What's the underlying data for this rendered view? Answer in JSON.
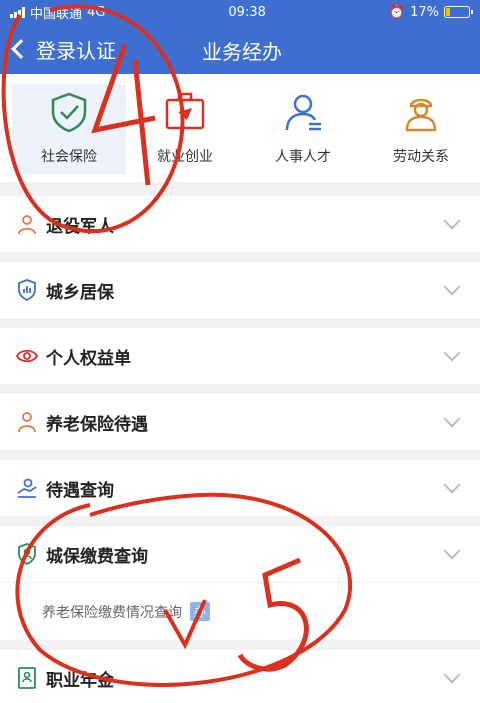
{
  "statusbar": {
    "carrier": "中国联通",
    "network": "4G",
    "time": "09:38",
    "battery": "17%"
  },
  "nav": {
    "back_label": "登录认证",
    "title": "业务经办"
  },
  "categories": [
    {
      "label": "社会保险",
      "icon": "shield-check-icon",
      "active": true
    },
    {
      "label": "就业创业",
      "icon": "briefcase-icon"
    },
    {
      "label": "人事人才",
      "icon": "person-card-icon"
    },
    {
      "label": "劳动关系",
      "icon": "worker-icon"
    }
  ],
  "rows": [
    {
      "label": "退役军人",
      "icon": "soldier-icon"
    },
    {
      "label": "城乡居保",
      "icon": "shield-chart-icon"
    },
    {
      "label": "个人权益单",
      "icon": "eye-icon"
    },
    {
      "label": "养老保险待遇",
      "icon": "elder-icon"
    },
    {
      "label": "待遇查询",
      "icon": "hand-money-icon"
    },
    {
      "label": "城保缴费查询",
      "icon": "shield-person-icon",
      "expanded": true
    },
    {
      "label": "职业年金",
      "icon": "document-person-icon"
    }
  ],
  "subitem": {
    "label": "养老保险缴费情况查询",
    "badge": "办"
  },
  "annotations": {
    "mark4": "4",
    "mark5": "5"
  },
  "colors": {
    "primary": "#3e6fd0",
    "annotation": "#d9301f",
    "icon_orange": "#e07a4a",
    "icon_blue": "#3e6fd0"
  }
}
